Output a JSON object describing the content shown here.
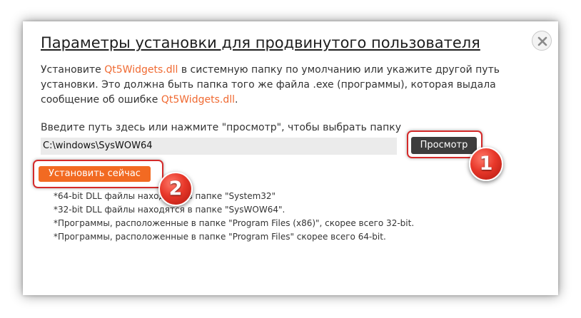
{
  "dialog": {
    "title": "Параметры установки для продвинутого пользователя",
    "description": {
      "part1": "Установите ",
      "link1": "Qt5Widgets.dll",
      "part2": " в системную папку по умолчанию или укажите другой путь установки. Это должна быть папка того же файла .exe (программы), которая выдала сообщение об ошибке ",
      "link2": "Qt5Widgets.dll",
      "part3": "."
    },
    "path_prompt": "Введите путь здесь или нажмите \"просмотр\", чтобы выбрать папку",
    "path_value": "C:\\windows\\SysWOW64",
    "browse_label": "Просмотр",
    "install_label": "Установить сейчас",
    "markers": [
      "1",
      "2"
    ],
    "notes": [
      "*64-bit DLL файлы находятся в папке \"System32\"",
      "*32-bit DLL файлы находятся в папке \"SysWOW64\".",
      "*Программы, расположенные в папке \"Program Files (x86)\", скорее всего 32-bit.",
      "*Программы, расположенные в папке \"Program Files\" скорее всего 64-bit."
    ]
  },
  "colors": {
    "accent": "#f26a22",
    "link": "#f06a32",
    "highlight": "#d42a2a",
    "browse_button": "#3d3d3d"
  },
  "icons": {
    "close": "close-icon"
  }
}
